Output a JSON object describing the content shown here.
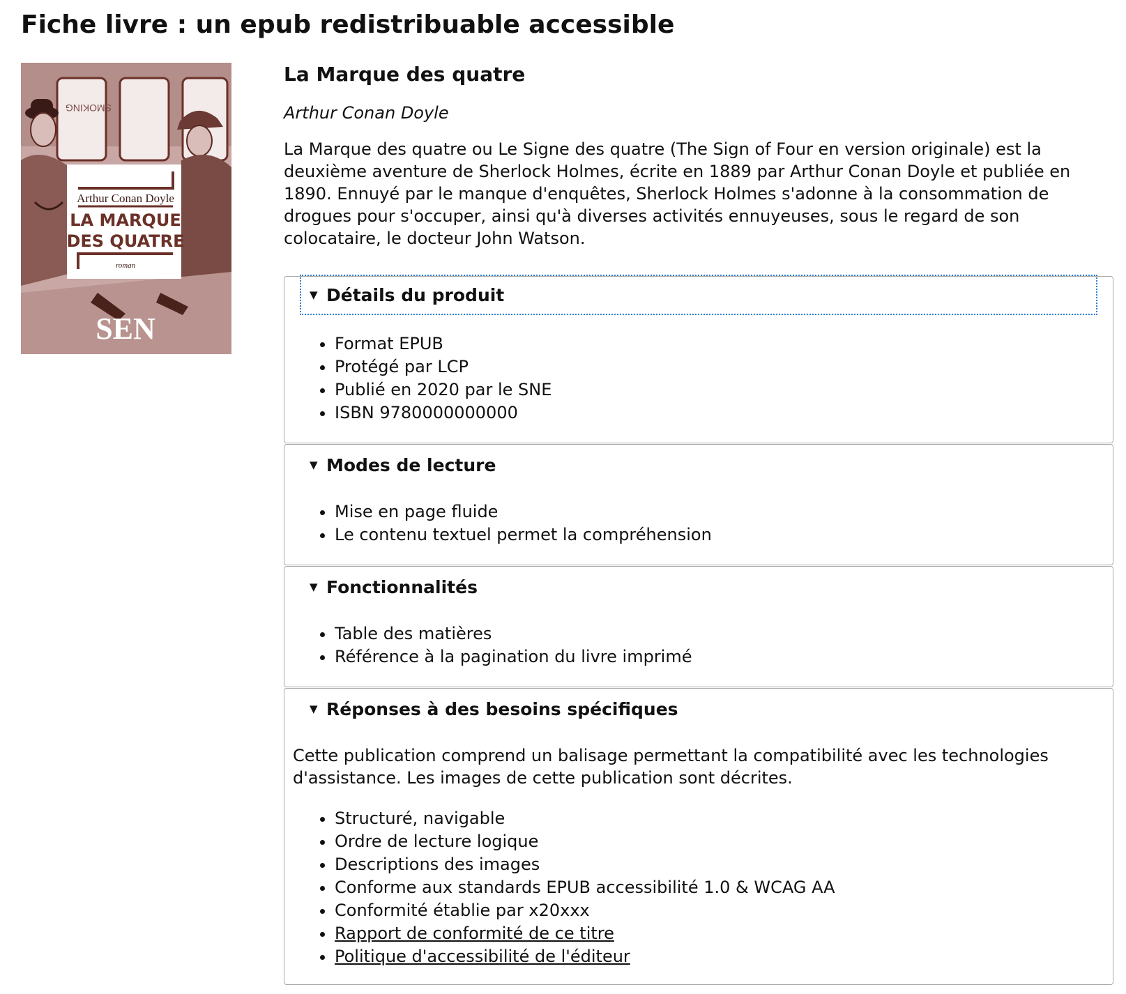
{
  "page": {
    "title": "Fiche livre : un epub redistribuable accessible"
  },
  "cover": {
    "icon": "book-cover-image",
    "author": "Arthur Conan Doyle",
    "title_line1": "LA MARQUE",
    "title_line2": "DES QUATRE",
    "genre": "roman",
    "sign_text": "SMOKING",
    "publisher_logo": "SEN",
    "colors": {
      "background": "#c9a9a6",
      "ink": "#6b3128",
      "panel": "#ffffff"
    }
  },
  "book": {
    "title": "La Marque des quatre",
    "author": "Arthur Conan Doyle",
    "description": "La Marque des quatre ou Le Signe des quatre (The Sign of Four en version originale) est la deuxième aventure de Sherlock Holmes, écrite en 1889 par Arthur Conan Doyle et publiée en 1890. Ennuyé par le manque d'enquêtes, Sherlock Holmes s'adonne à la consommation de drogues pour s'occuper, ainsi qu'à diverses activités ennuyeuses, sous le regard de son colocataire, le docteur John Watson."
  },
  "sections": {
    "details": {
      "label": "Détails du produit",
      "items": [
        "Format EPUB",
        "Protégé par LCP",
        "Publié en 2020 par le SNE",
        "ISBN 9780000000000"
      ]
    },
    "reading_modes": {
      "label": "Modes de lecture",
      "items": [
        "Mise en page fluide",
        "Le contenu textuel permet la compréhension"
      ]
    },
    "features": {
      "label": "Fonctionnalités",
      "items": [
        "Table des matières",
        "Référence à la pagination du livre imprimé"
      ]
    },
    "needs": {
      "label": "Réponses à des besoins spécifiques",
      "note": "Cette publication comprend un balisage permettant la compatibilité avec les technologies d'assistance. Les images de cette publication sont décrites.",
      "items": [
        "Structuré, navigable",
        "Ordre de lecture logique",
        "Descriptions des images",
        "Conforme aux standards EPUB accessibilité 1.0 & WCAG AA",
        "Conformité établie par x20xxx"
      ],
      "links": [
        "Rapport de conformité de ce titre",
        "Politique d'accessibilité de l'éditeur"
      ]
    }
  },
  "disclosure_icon": "triangle-down-icon",
  "triangle_glyph": "▼"
}
